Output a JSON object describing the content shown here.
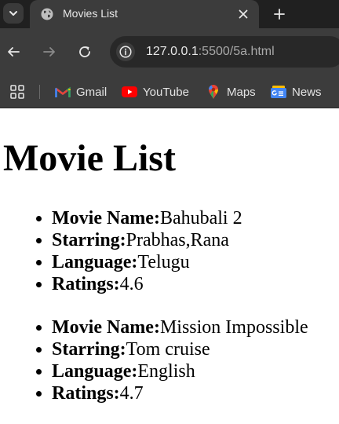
{
  "browser": {
    "tab_title": "Movies List",
    "url_host": "127.0.0.1",
    "url_rest": ":5500/5a.html",
    "bookmarks": [
      {
        "label": "Gmail",
        "icon": "gmail-icon"
      },
      {
        "label": "YouTube",
        "icon": "youtube-icon"
      },
      {
        "label": "Maps",
        "icon": "maps-icon"
      },
      {
        "label": "News",
        "icon": "news-icon"
      }
    ]
  },
  "page": {
    "heading": "Movie List",
    "movies": [
      {
        "name_label": "Movie Name:",
        "name": "Bahubali 2",
        "starring_label": "Starring:",
        "starring": "Prabhas,Rana",
        "language_label": "Language:",
        "language": "Telugu",
        "ratings_label": "Ratings:",
        "ratings": "4.6"
      },
      {
        "name_label": "Movie Name:",
        "name": "Mission Impossible",
        "starring_label": "Starring:",
        "starring": "Tom cruise",
        "language_label": "Language:",
        "language": "English",
        "ratings_label": "Ratings:",
        "ratings": "4.7"
      }
    ]
  },
  "colors": {
    "tabstrip": "#202020",
    "toolbar": "#3c3c3c",
    "omnibox": "#282828",
    "page_background": "#ffffff"
  }
}
